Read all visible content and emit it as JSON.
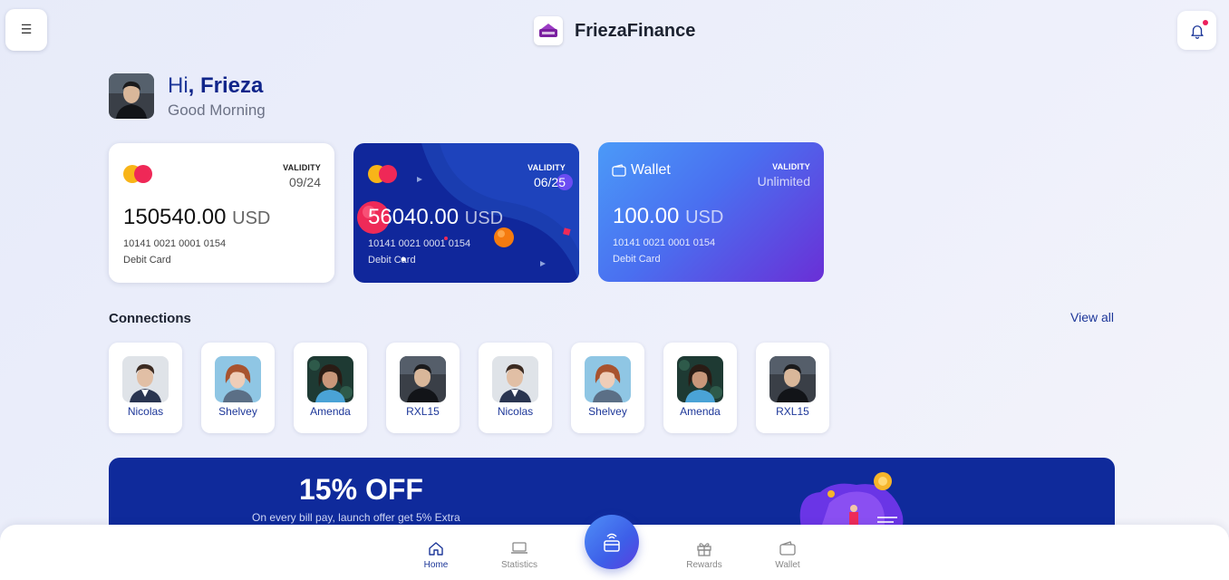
{
  "header": {
    "menu_icon": "hamburger-icon",
    "brand_name": "FriezaFinance",
    "brand_logo_text": "Frieza",
    "notification_icon": "bell-icon",
    "notification_dot_color": "#ec1f5c"
  },
  "greeting": {
    "hi": "Hi",
    "name": ", Frieza",
    "subtitle": "Good Morning"
  },
  "cards": [
    {
      "validity_label": "VALIDITY",
      "validity": "09/24",
      "amount": "150540.00",
      "currency": "USD",
      "number": "10141 0021 0001 0154",
      "type": "Debit Card"
    },
    {
      "validity_label": "VALIDITY",
      "validity": "06/25",
      "amount": "56040.00",
      "currency": "USD",
      "number": "10141 0021 0001 0154",
      "type": "Debit Card"
    },
    {
      "title": "Wallet",
      "validity_label": "VALIDITY",
      "validity": "Unlimited",
      "amount": "100.00",
      "currency": "USD",
      "number": "10141 0021 0001 0154",
      "type": "Debit Card"
    }
  ],
  "connections": {
    "title": "Connections",
    "view_all": "View all",
    "items": [
      {
        "name": "Nicolas"
      },
      {
        "name": "Shelvey"
      },
      {
        "name": "Amenda"
      },
      {
        "name": "RXL15"
      },
      {
        "name": "Nicolas"
      },
      {
        "name": "Shelvey"
      },
      {
        "name": "Amenda"
      },
      {
        "name": "RXL15"
      }
    ]
  },
  "promo": {
    "title": "15% OFF",
    "subtitle": "On every bill pay, launch offer get 5% Extra"
  },
  "bottom_nav": {
    "home": "Home",
    "statistics": "Statistics",
    "rewards": "Rewards",
    "wallet": "Wallet"
  },
  "colors": {
    "accent": "#1d3799",
    "card_blue": "#10279b",
    "promo_bg": "#0f2a9b"
  }
}
